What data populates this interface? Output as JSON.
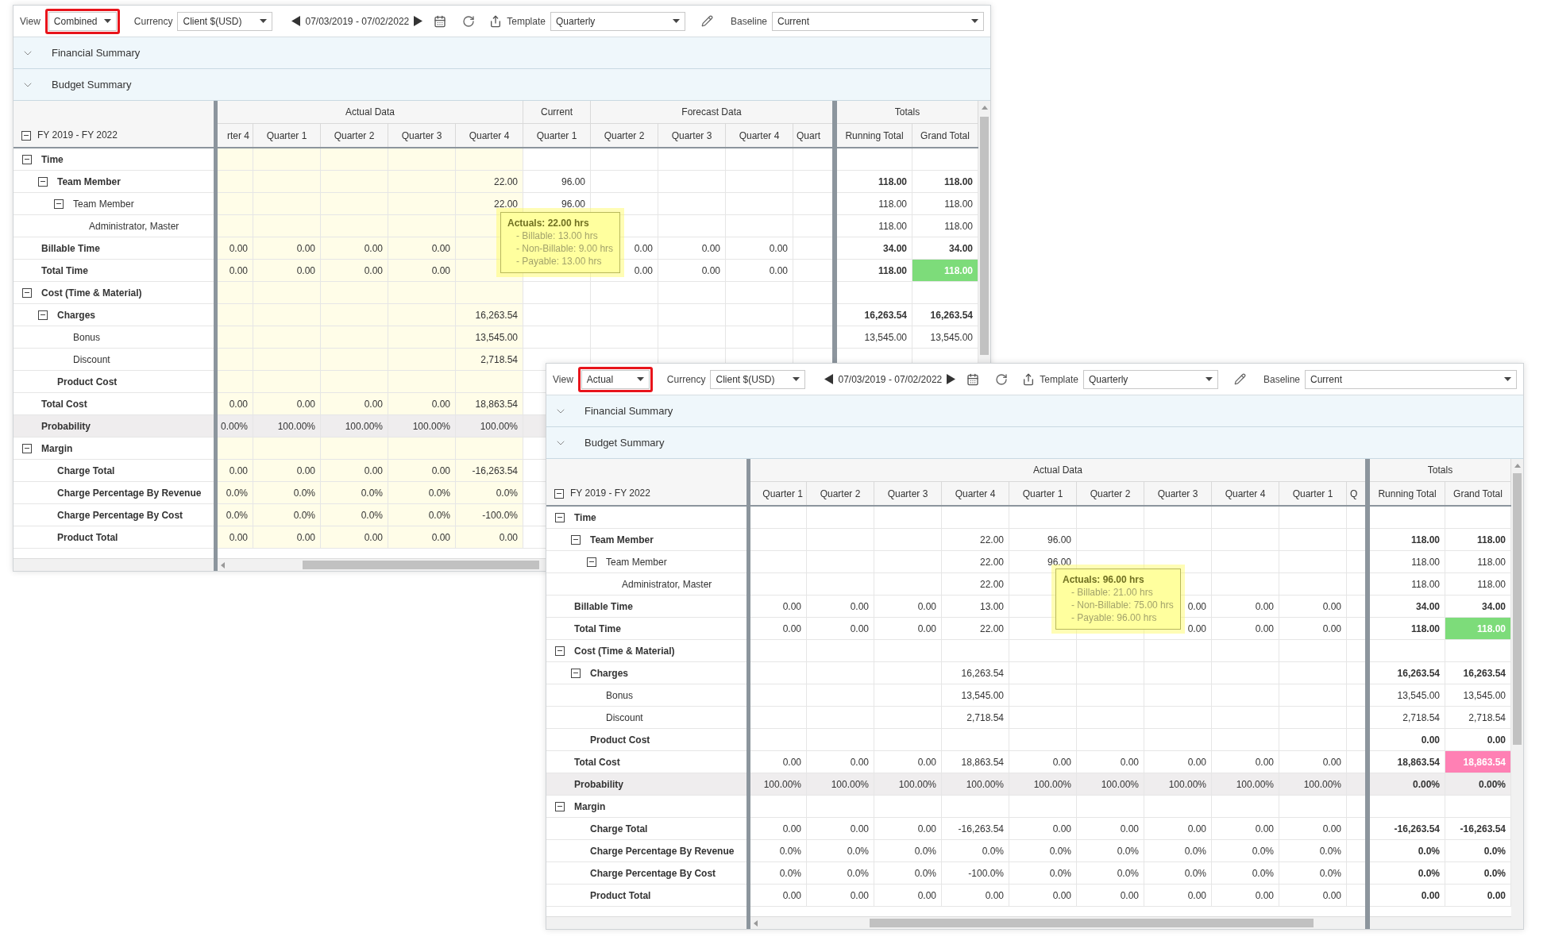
{
  "windows": [
    {
      "toolbar": {
        "view": {
          "label": "View",
          "value": "Combined",
          "highlighted": true
        },
        "currency": {
          "label": "Currency",
          "value": "Client $(USD)"
        },
        "date_range": "07/03/2019 - 07/02/2022",
        "template": {
          "label": "Template",
          "value": "Quarterly"
        },
        "baseline": {
          "label": "Baseline",
          "value": "Current"
        }
      },
      "sections": [
        "Financial Summary",
        "Budget Summary"
      ],
      "grid": {
        "header": {
          "label": "FY 2019 - FY 2022",
          "expanded": true
        },
        "column_groups": [
          {
            "label": "Actual Data",
            "highlighted": true,
            "columns": [
              {
                "label": "rter 4",
                "kind": "leading"
              },
              {
                "label": "Quarter 1",
                "kind": "full"
              },
              {
                "label": "Quarter 2",
                "kind": "full"
              },
              {
                "label": "Quarter 3",
                "kind": "full"
              },
              {
                "label": "Quarter 4",
                "kind": "full"
              }
            ]
          },
          {
            "label": "Current",
            "highlighted": false,
            "columns": [
              {
                "label": "Quarter 1",
                "kind": "full"
              }
            ]
          },
          {
            "label": "Forecast Data",
            "highlighted": false,
            "columns": [
              {
                "label": "Quarter 2",
                "kind": "full"
              },
              {
                "label": "Quarter 3",
                "kind": "full"
              },
              {
                "label": "Quarter 4",
                "kind": "full"
              },
              {
                "label": "Quart",
                "kind": "trailing"
              }
            ]
          }
        ],
        "totals_group": {
          "label": "Totals",
          "columns": [
            "Running Total",
            "Grand Total"
          ]
        },
        "rows": [
          {
            "label": "Time",
            "kind": "group",
            "expanded": true,
            "children": [
              {
                "label": "Team Member",
                "kind": "group",
                "expanded": true,
                "values": [
                  {
                    "kind": "empty"
                  },
                  {
                    "kind": "empty"
                  },
                  {
                    "kind": "empty"
                  },
                  {
                    "kind": "empty"
                  },
                  "22.00",
                  "96.00"
                ],
                "totals": [
                  "118.00",
                  "118.00"
                ],
                "children": [
                  {
                    "label": "Team Member",
                    "kind": "group",
                    "expanded": true,
                    "values": [
                      {
                        "kind": "empty"
                      },
                      {
                        "kind": "empty"
                      },
                      {
                        "kind": "empty"
                      },
                      {
                        "kind": "empty"
                      },
                      "22.00",
                      "96.00"
                    ],
                    "totals": [
                      "118.00",
                      "118.00"
                    ],
                    "children": [
                      {
                        "label": "Administrator, Master",
                        "kind": "line",
                        "totals": [
                          "118.00",
                          "118.00"
                        ]
                      }
                    ]
                  }
                ]
              }
            ]
          },
          {
            "label": "Billable Time",
            "kind": "line",
            "values": [
              "0.00",
              "0.00",
              "0.00",
              "0.00",
              {
                "kind": "empty"
              },
              {
                "kind": "empty"
              },
              "0.00",
              "0.00",
              "0.00"
            ],
            "totals": [
              "34.00",
              "34.00"
            ]
          },
          {
            "label": "Total Time",
            "kind": "line",
            "values": [
              "0.00",
              "0.00",
              "0.00",
              "0.00",
              {
                "kind": "empty"
              },
              {
                "kind": "empty"
              },
              "0.00",
              "0.00",
              "0.00"
            ],
            "totals": [
              "118.00",
              {
                "text": "118.00",
                "color": "#7ddc7a"
              }
            ]
          },
          {
            "label": "Cost (Time & Material)",
            "kind": "group",
            "expanded": true,
            "children": [
              {
                "label": "Charges",
                "kind": "group",
                "expanded": true,
                "values": [
                  {
                    "kind": "empty"
                  },
                  {
                    "kind": "empty"
                  },
                  {
                    "kind": "empty"
                  },
                  {
                    "kind": "empty"
                  },
                  "16,263.54"
                ],
                "totals": [
                  "16,263.54",
                  "16,263.54"
                ],
                "children": [
                  {
                    "label": "Bonus",
                    "kind": "line",
                    "values": [
                      {
                        "kind": "empty"
                      },
                      {
                        "kind": "empty"
                      },
                      {
                        "kind": "empty"
                      },
                      {
                        "kind": "empty"
                      },
                      "13,545.00"
                    ],
                    "totals": [
                      "13,545.00",
                      "13,545.00"
                    ]
                  },
                  {
                    "label": "Discount",
                    "kind": "line",
                    "values": [
                      {
                        "kind": "empty"
                      },
                      {
                        "kind": "empty"
                      },
                      {
                        "kind": "empty"
                      },
                      {
                        "kind": "empty"
                      },
                      "2,718.54"
                    ]
                  }
                ]
              },
              {
                "label": "Product Cost",
                "kind": "line"
              }
            ]
          },
          {
            "label": "Total Cost",
            "kind": "line",
            "values": [
              "0.00",
              "0.00",
              "0.00",
              "0.00",
              "18,863.54"
            ]
          },
          {
            "label": "Probability",
            "kind": "shaded",
            "values": [
              "0.00%",
              "100.00%",
              "100.00%",
              "100.00%",
              "100.00%"
            ]
          },
          {
            "label": "Margin",
            "kind": "group",
            "expanded": true,
            "children": [
              {
                "label": "Charge Total",
                "kind": "line",
                "values": [
                  "0.00",
                  "0.00",
                  "0.00",
                  "0.00",
                  "-16,263.54"
                ]
              },
              {
                "label": "Charge Percentage By Revenue",
                "kind": "line",
                "values": [
                  "0.0%",
                  "0.0%",
                  "0.0%",
                  "0.0%",
                  "0.0%"
                ]
              },
              {
                "label": "Charge Percentage By Cost",
                "kind": "line",
                "values": [
                  "0.0%",
                  "0.0%",
                  "0.0%",
                  "0.0%",
                  "-100.0%"
                ]
              },
              {
                "label": "Product Total",
                "kind": "line",
                "values": [
                  "0.00",
                  "0.00",
                  "0.00",
                  "0.00",
                  "0.00"
                ]
              }
            ]
          }
        ]
      },
      "tooltip": {
        "title": "Actuals: 22.00 hrs",
        "lines": [
          "- Billable: 13.00 hrs",
          "- Non-Billable: 9.00 hrs",
          "- Payable: 13.00 hrs"
        ]
      }
    },
    {
      "toolbar": {
        "view": {
          "label": "View",
          "value": "Actual",
          "highlighted": true
        },
        "currency": {
          "label": "Currency",
          "value": "Client $(USD)"
        },
        "date_range": "07/03/2019 - 07/02/2022",
        "template": {
          "label": "Template",
          "value": "Quarterly"
        },
        "baseline": {
          "label": "Baseline",
          "value": "Current"
        }
      },
      "sections": [
        "Financial Summary",
        "Budget Summary"
      ],
      "grid": {
        "header": {
          "label": "FY 2019 - FY 2022",
          "expanded": true
        },
        "column_groups": [
          {
            "label": "Actual Data",
            "highlighted": false,
            "columns": [
              {
                "label": "Quarter 1",
                "kind": "leading"
              },
              {
                "label": "Quarter 2",
                "kind": "full"
              },
              {
                "label": "Quarter 3",
                "kind": "full"
              },
              {
                "label": "Quarter 4",
                "kind": "full"
              },
              {
                "label": "Quarter 1",
                "kind": "full"
              },
              {
                "label": "Quarter 2",
                "kind": "full"
              },
              {
                "label": "Quarter 3",
                "kind": "full"
              },
              {
                "label": "Quarter 4",
                "kind": "full"
              },
              {
                "label": "Quarter 1",
                "kind": "full"
              },
              {
                "label": "Q",
                "kind": "trailing"
              }
            ]
          }
        ],
        "totals_group": {
          "label": "Totals",
          "columns": [
            "Running Total",
            "Grand Total"
          ]
        },
        "rows": [
          {
            "label": "Time",
            "kind": "group",
            "expanded": true,
            "children": [
              {
                "label": "Team Member",
                "kind": "group",
                "expanded": true,
                "values": [
                  {
                    "kind": "empty"
                  },
                  {
                    "kind": "empty"
                  },
                  {
                    "kind": "empty"
                  },
                  "22.00",
                  "96.00"
                ],
                "totals": [
                  "118.00",
                  "118.00"
                ],
                "children": [
                  {
                    "label": "Team Member",
                    "kind": "group",
                    "expanded": true,
                    "values": [
                      {
                        "kind": "empty"
                      },
                      {
                        "kind": "empty"
                      },
                      {
                        "kind": "empty"
                      },
                      "22.00",
                      "96.00"
                    ],
                    "totals": [
                      "118.00",
                      "118.00"
                    ],
                    "children": [
                      {
                        "label": "Administrator, Master",
                        "kind": "line",
                        "values": [
                          {
                            "kind": "empty"
                          },
                          {
                            "kind": "empty"
                          },
                          {
                            "kind": "empty"
                          },
                          "22.00"
                        ],
                        "totals": [
                          "118.00",
                          "118.00"
                        ]
                      }
                    ]
                  }
                ]
              }
            ]
          },
          {
            "label": "Billable Time",
            "kind": "line",
            "values": [
              "0.00",
              "0.00",
              "0.00",
              "13.00",
              {
                "kind": "empty"
              },
              {
                "kind": "empty"
              },
              "0.00",
              "0.00",
              "0.00"
            ],
            "totals": [
              "34.00",
              "34.00"
            ]
          },
          {
            "label": "Total Time",
            "kind": "line",
            "values": [
              "0.00",
              "0.00",
              "0.00",
              "22.00",
              {
                "kind": "empty"
              },
              {
                "kind": "empty"
              },
              "0.00",
              "0.00",
              "0.00"
            ],
            "totals": [
              "118.00",
              {
                "text": "118.00",
                "color": "#7ddc7a"
              }
            ]
          },
          {
            "label": "Cost (Time & Material)",
            "kind": "group",
            "expanded": true,
            "children": [
              {
                "label": "Charges",
                "kind": "group",
                "expanded": true,
                "values": [
                  {
                    "kind": "empty"
                  },
                  {
                    "kind": "empty"
                  },
                  {
                    "kind": "empty"
                  },
                  "16,263.54"
                ],
                "totals": [
                  "16,263.54",
                  "16,263.54"
                ],
                "children": [
                  {
                    "label": "Bonus",
                    "kind": "line",
                    "values": [
                      {
                        "kind": "empty"
                      },
                      {
                        "kind": "empty"
                      },
                      {
                        "kind": "empty"
                      },
                      "13,545.00"
                    ],
                    "totals": [
                      "13,545.00",
                      "13,545.00"
                    ]
                  },
                  {
                    "label": "Discount",
                    "kind": "line",
                    "values": [
                      {
                        "kind": "empty"
                      },
                      {
                        "kind": "empty"
                      },
                      {
                        "kind": "empty"
                      },
                      "2,718.54"
                    ],
                    "totals": [
                      "2,718.54",
                      "2,718.54"
                    ]
                  }
                ]
              },
              {
                "label": "Product Cost",
                "kind": "line",
                "totals": [
                  "0.00",
                  "0.00"
                ]
              }
            ]
          },
          {
            "label": "Total Cost",
            "kind": "line",
            "values": [
              "0.00",
              "0.00",
              "0.00",
              "18,863.54",
              "0.00",
              "0.00",
              "0.00",
              "0.00",
              "0.00"
            ],
            "totals": [
              "18,863.54",
              {
                "text": "18,863.54",
                "color": "#ff80b4"
              }
            ]
          },
          {
            "label": "Probability",
            "kind": "shaded",
            "values": [
              "100.00%",
              "100.00%",
              "100.00%",
              "100.00%",
              "100.00%",
              "100.00%",
              "100.00%",
              "100.00%",
              "100.00%"
            ],
            "totals": [
              "0.00%",
              "0.00%"
            ]
          },
          {
            "label": "Margin",
            "kind": "group",
            "expanded": true,
            "children": [
              {
                "label": "Charge Total",
                "kind": "line",
                "values": [
                  "0.00",
                  "0.00",
                  "0.00",
                  "-16,263.54",
                  "0.00",
                  "0.00",
                  "0.00",
                  "0.00",
                  "0.00"
                ],
                "totals": [
                  "-16,263.54",
                  "-16,263.54"
                ]
              },
              {
                "label": "Charge Percentage By Revenue",
                "kind": "line",
                "values": [
                  "0.0%",
                  "0.0%",
                  "0.0%",
                  "0.0%",
                  "0.0%",
                  "0.0%",
                  "0.0%",
                  "0.0%",
                  "0.0%"
                ],
                "totals": [
                  "0.0%",
                  "0.0%"
                ]
              },
              {
                "label": "Charge Percentage By Cost",
                "kind": "line",
                "values": [
                  "0.0%",
                  "0.0%",
                  "0.0%",
                  "-100.0%",
                  "0.0%",
                  "0.0%",
                  "0.0%",
                  "0.0%",
                  "0.0%"
                ],
                "totals": [
                  "0.0%",
                  "0.0%"
                ]
              },
              {
                "label": "Product Total",
                "kind": "line",
                "values": [
                  "0.00",
                  "0.00",
                  "0.00",
                  "0.00",
                  "0.00",
                  "0.00",
                  "0.00",
                  "0.00",
                  "0.00"
                ],
                "totals": [
                  "0.00",
                  "0.00"
                ]
              }
            ]
          }
        ]
      },
      "tooltip": {
        "title": "Actuals: 96.00 hrs",
        "lines": [
          "- Billable: 21.00 hrs",
          "- Non-Billable: 75.00 hrs",
          "- Payable: 96.00 hrs"
        ]
      }
    }
  ]
}
